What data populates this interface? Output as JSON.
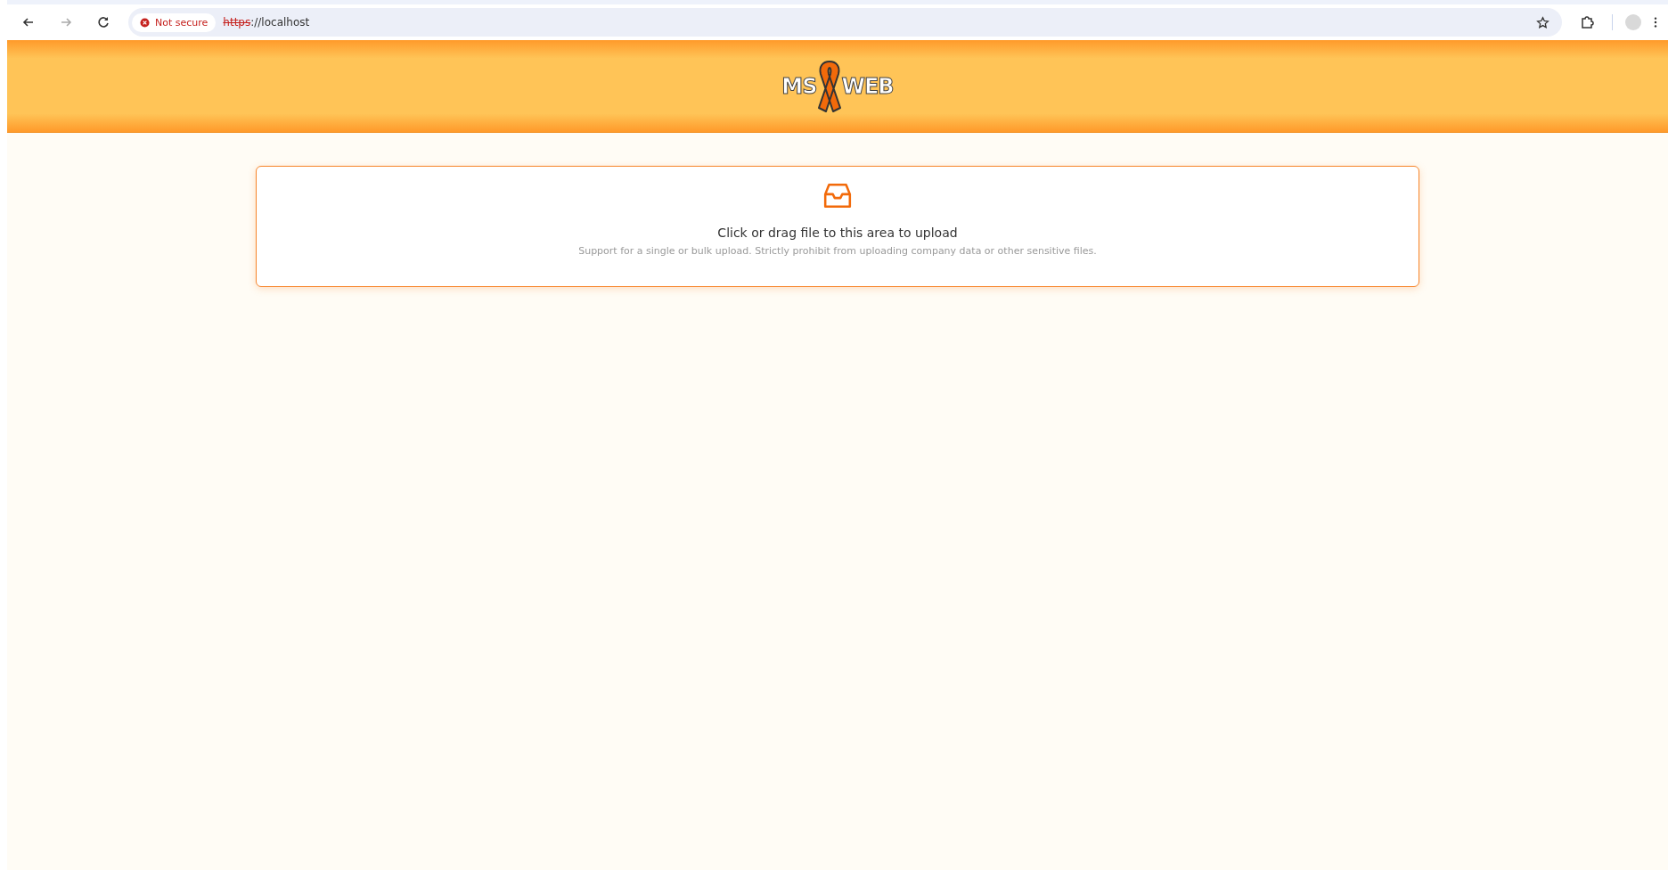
{
  "browser": {
    "security_label": "Not secure",
    "url_scheme": "https",
    "url_rest": "://localhost"
  },
  "header": {
    "logo_left": "MS",
    "logo_right": "WEB"
  },
  "upload": {
    "title": "Click or drag file to this area to upload",
    "hint": "Support for a single or bulk upload. Strictly prohibit from uploading company data or other sensitive files."
  }
}
